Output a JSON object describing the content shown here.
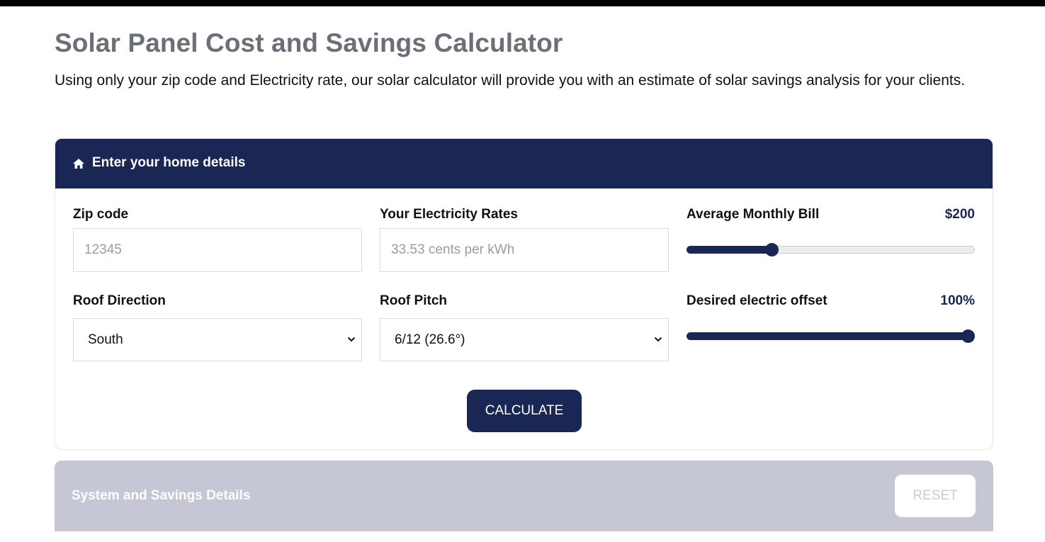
{
  "page": {
    "title": "Solar Panel Cost and Savings Calculator",
    "intro": "Using only your zip code and Electricity rate, our solar calculator will provide you with an estimate of solar savings analysis for your clients."
  },
  "home_details": {
    "header_icon": "home-icon",
    "header_title": "Enter your home details",
    "zip_code": {
      "label": "Zip code",
      "value": "",
      "placeholder": "12345"
    },
    "electricity_rate": {
      "label": "Your Electricity Rates",
      "value": "",
      "placeholder": "33.53 cents per kWh"
    },
    "monthly_bill": {
      "label": "Average Monthly Bill",
      "display_value": "$200",
      "slider_fraction": 0.285
    },
    "roof_direction": {
      "label": "Roof Direction",
      "selected": "South"
    },
    "roof_pitch": {
      "label": "Roof Pitch",
      "selected": "6/12 (26.6°)"
    },
    "electric_offset": {
      "label": "Desired electric offset",
      "display_value": "100%",
      "slider_fraction": 1.0
    },
    "calculate_label": "CALCULATE"
  },
  "savings": {
    "title": "System and Savings Details",
    "reset_label": "RESET"
  },
  "colors": {
    "brand_navy": "#1a2654",
    "title_gray": "#6b6f78",
    "disabled_panel": "#c5c7d4"
  }
}
